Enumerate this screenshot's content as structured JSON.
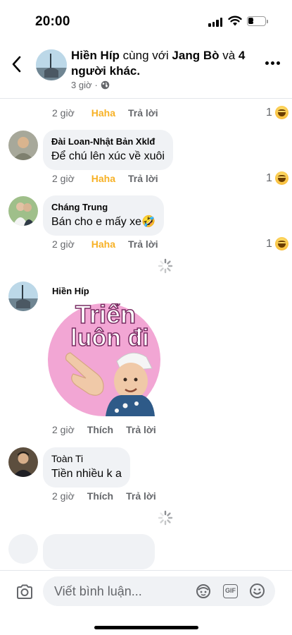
{
  "status_bar": {
    "time": "20:00",
    "battery": "34",
    "battery_level": 0.34
  },
  "header": {
    "title_author": "Hiền Híp",
    "title_with": " cùng với ",
    "title_tagged": "Jang Bò",
    "title_and": " và ",
    "title_others": "4 người khác.",
    "time": "3 giờ",
    "privacy_icon": "globe-icon"
  },
  "comments": [
    {
      "time": "2 giờ",
      "reaction_label": "Haha",
      "reply_label": "Trả lời",
      "reaction_count": "1",
      "reaction_icon": "haha-emoji"
    },
    {
      "author": "Đài Loan-Nhật Bản Xklđ",
      "text": "Để chú lên xúc về xuôi",
      "time": "2 giờ",
      "reaction_label": "Haha",
      "reply_label": "Trả lời",
      "reaction_count": "1",
      "reaction_icon": "haha-emoji"
    },
    {
      "author": "Cháng Trung",
      "text": "Bán cho e mấy xe🤣",
      "time": "2 giờ",
      "reaction_label": "Haha",
      "reply_label": "Trả lời",
      "reaction_count": "1",
      "reaction_icon": "haha-emoji"
    },
    {
      "author": "Hiền Híp",
      "sticker_text": [
        "Triển",
        "luôn đi"
      ],
      "time": "2 giờ",
      "like_label": "Thích",
      "reply_label": "Trả lời"
    },
    {
      "author": "Toàn Ti",
      "text": "Tiền nhiều k a",
      "time": "2 giờ",
      "like_label": "Thích",
      "reply_label": "Trả lời"
    }
  ],
  "composer": {
    "placeholder": "Viết bình luận...",
    "gif_label": "GIF",
    "icons": [
      "camera-icon",
      "avatar-sticker-icon",
      "gif-icon",
      "emoji-icon"
    ]
  },
  "colors": {
    "haha": "#f7b125",
    "bubble": "#f0f2f5",
    "muted_text": "#65676b",
    "sticker_bg": "#f2a6d4"
  }
}
